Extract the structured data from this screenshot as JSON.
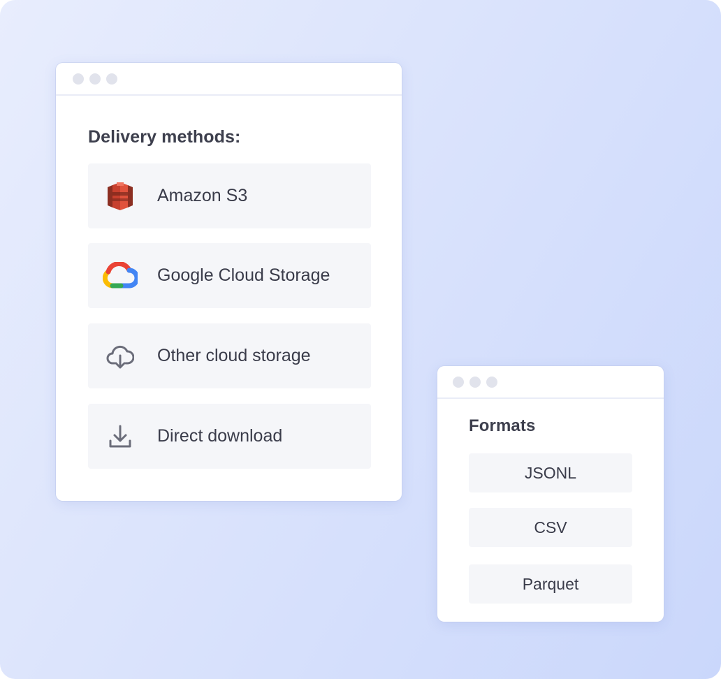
{
  "delivery": {
    "title": "Delivery methods:",
    "methods": [
      {
        "label": "Amazon S3",
        "icon": "amazon-s3-icon"
      },
      {
        "label": "Google Cloud Storage",
        "icon": "google-cloud-icon"
      },
      {
        "label": "Other cloud storage",
        "icon": "cloud-download-icon"
      },
      {
        "label": "Direct download",
        "icon": "download-icon"
      }
    ]
  },
  "formats": {
    "title": "Formats",
    "items": [
      "JSONL",
      "CSV",
      "Parquet"
    ]
  },
  "colors": {
    "background_start": "#e8edfd",
    "background_end": "#cad7fb",
    "s3_red": "#c7402e",
    "google_blue": "#4285f4",
    "google_red": "#ea4335",
    "google_yellow": "#fbbc04",
    "google_green": "#34a853",
    "icon_gray": "#6b6d7a"
  }
}
